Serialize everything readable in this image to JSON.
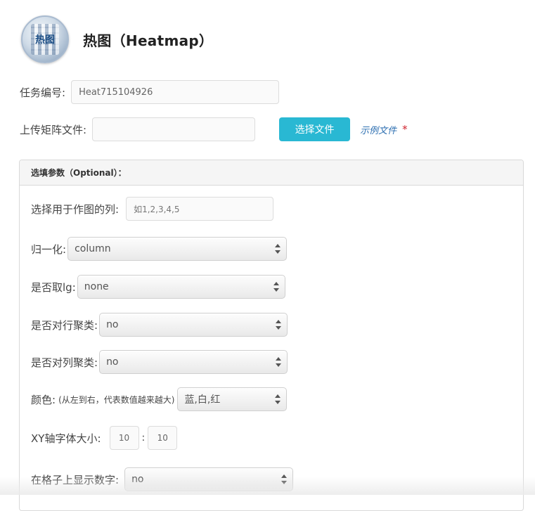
{
  "header": {
    "logo_text": "热图",
    "title": "热图（Heatmap）"
  },
  "task": {
    "label": "任务编号:",
    "value": "Heat715104926"
  },
  "upload": {
    "label": "上传矩阵文件:",
    "file_value": "",
    "button_label": "选择文件",
    "example_link": "示例文件",
    "required_mark": "*"
  },
  "panel": {
    "title": "选填参数（Optional）：",
    "columns": {
      "label": "选择用于作图的列:",
      "placeholder": "如1,2,3,4,5"
    },
    "normalize": {
      "label": "归一化:",
      "value": "column"
    },
    "log": {
      "label": "是否取lg:",
      "value": "none"
    },
    "row_cluster": {
      "label": "是否对行聚类:",
      "value": "no"
    },
    "col_cluster": {
      "label": "是否对列聚类:",
      "value": "no"
    },
    "color": {
      "label": "颜色:",
      "note": "(从左到右，代表数值越来越大)",
      "value": "蓝,白,红"
    },
    "font_size": {
      "label": "XY轴字体大小:",
      "x_value": "10",
      "sep": ":",
      "y_value": "10"
    },
    "show_numbers": {
      "label": "在格子上显示数字:",
      "value": "no"
    }
  },
  "colors": {
    "accent": "#29b8d3",
    "link": "#2a6db0",
    "required": "#d0232e"
  }
}
